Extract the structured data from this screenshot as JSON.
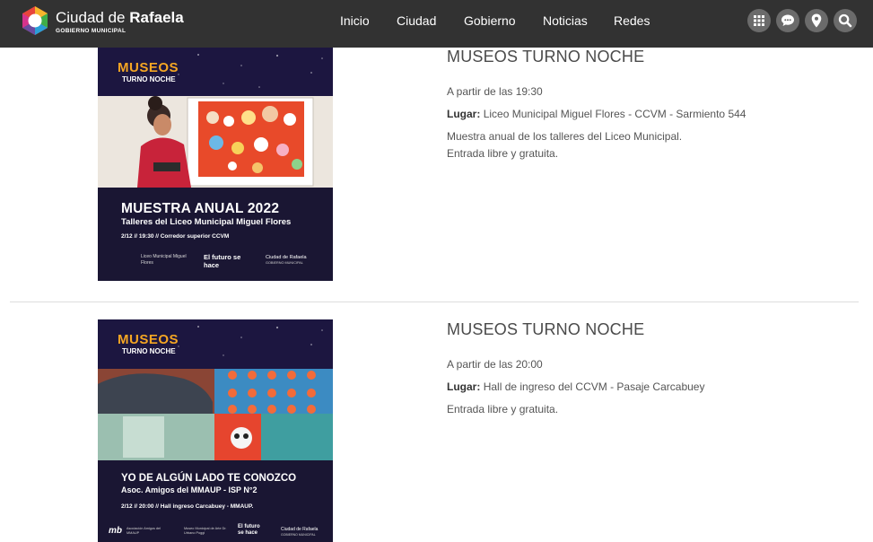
{
  "header": {
    "brand_prefix": "Ciudad de ",
    "brand_bold": "Rafaela",
    "brand_sub": "GOBIERNO MUNICIPAL",
    "nav": [
      "Inicio",
      "Ciudad",
      "Gobierno",
      "Noticias",
      "Redes"
    ],
    "icons": [
      "grid-icon",
      "chat-icon",
      "location-pin-icon",
      "search-icon"
    ]
  },
  "events": [
    {
      "title": "MUSEOS TURNO NOCHE",
      "time": "A partir de las 19:30",
      "place_label": "Lugar:",
      "place": "Liceo Municipal Miguel Flores - CCVM - Sarmiento 544",
      "desc1": "Muestra anual de los talleres del Liceo Municipal.",
      "desc2": "Entrada libre y gratuita.",
      "poster": {
        "kicker": "MUSEOS",
        "kicker_sub": "TURNO NOCHE",
        "headline": "MUESTRA ANUAL 2022",
        "subhead": "Talleres del Liceo Municipal Miguel Flores",
        "info": "2/12 // 19:30 // Corredor superior CCVM",
        "footer_left": "Liceo Municipal Miguel Flores",
        "slogan": "El futuro se hace",
        "footer_right": "Ciudad de Rafaela",
        "footer_right_sub": "GOBIERNO MUNICIPAL"
      }
    },
    {
      "title": "MUSEOS TURNO NOCHE",
      "time": "A partir de las 20:00",
      "place_label": "Lugar:",
      "place": "Hall de ingreso del CCVM - Pasaje Carcabuey",
      "desc1": "Entrada libre y gratuita.",
      "poster": {
        "kicker": "MUSEOS",
        "kicker_sub": "TURNO NOCHE",
        "headline": "YO DE ALGÚN LADO TE CONOZCO",
        "subhead": "Asoc. Amigos del MMAUP - ISP N°2",
        "info": "2/12 // 20:00 // Hall ingreso Carcabuey - MMAUP.",
        "footer_left": "Asociación Amigos del MMAUP",
        "footer_mid": "Museo Municipal de Arte Dr. Urbano Poggi",
        "slogan": "El futuro se hace",
        "footer_right": "Ciudad de Rafaela",
        "footer_right_sub": "GOBIERNO MUNICIPAL"
      }
    }
  ],
  "colors": {
    "header_bg": "#323232",
    "icon_bg": "#6b6b6b",
    "poster_accent": "#f5a623",
    "poster_bg": "#1c1640"
  }
}
